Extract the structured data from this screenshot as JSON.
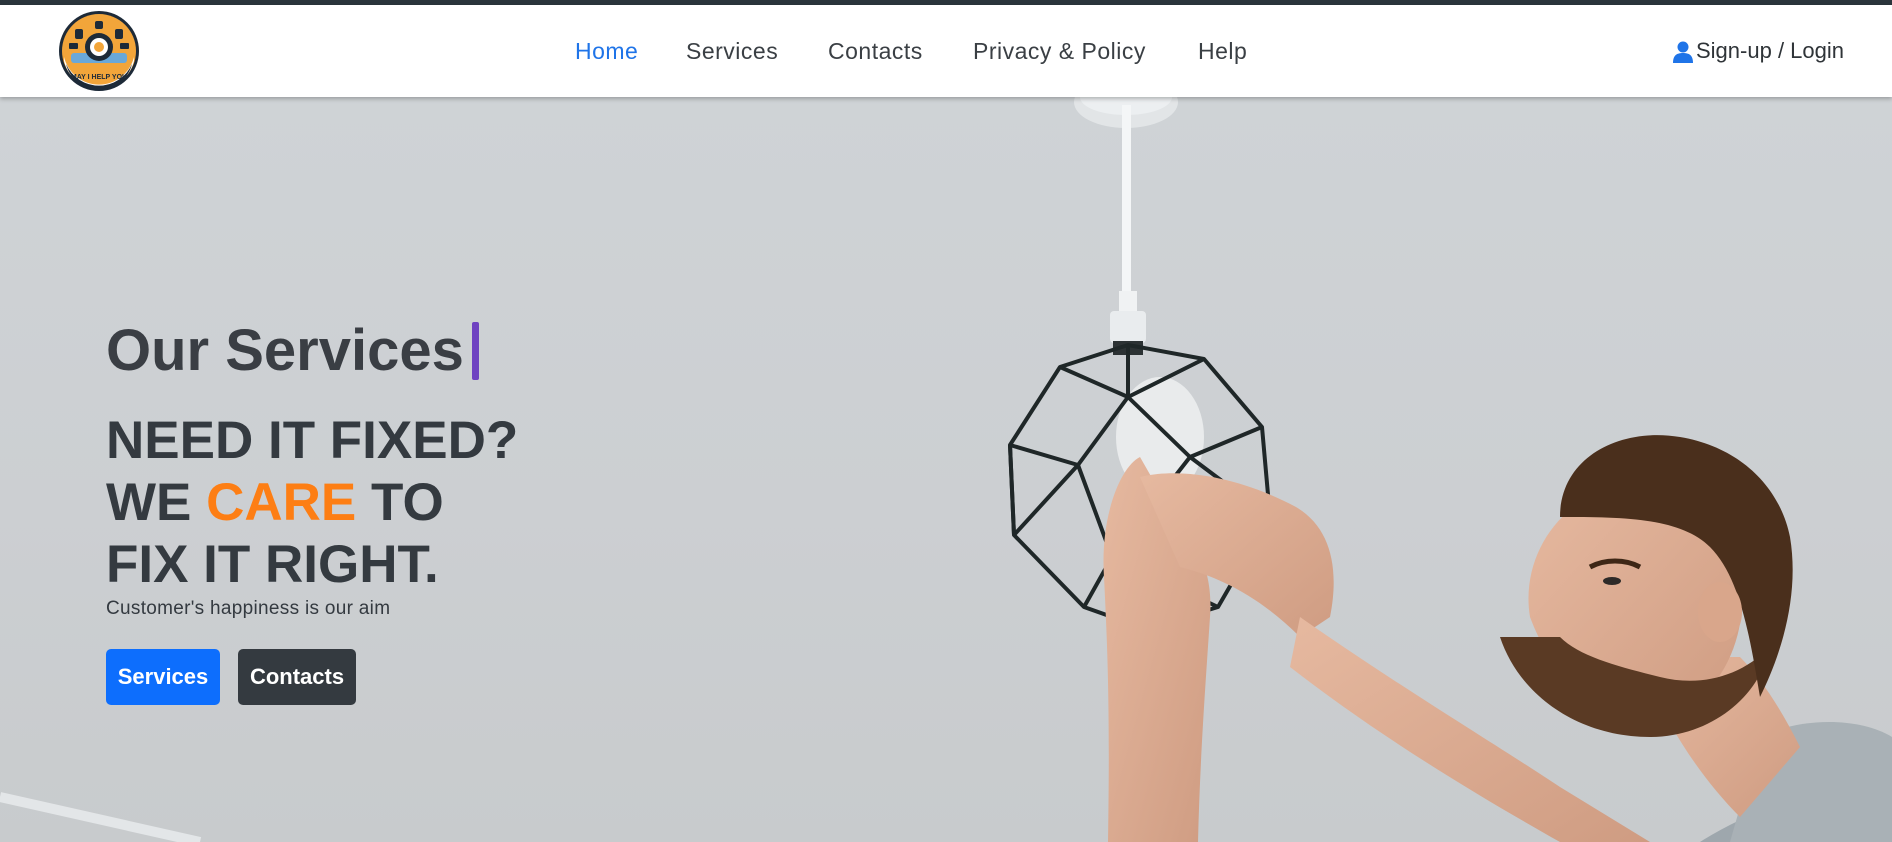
{
  "nav": {
    "logo_text": "MAY I HELP YOU",
    "links": [
      {
        "label": "Home",
        "active": true
      },
      {
        "label": "Services",
        "active": false
      },
      {
        "label": "Contacts",
        "active": false
      },
      {
        "label": "Privacy & Policy",
        "active": false
      },
      {
        "label": "Help",
        "active": false
      }
    ],
    "login_label": "Sign-up / Login",
    "login_icon": "user-icon"
  },
  "hero": {
    "typing_text": "Our Services",
    "headline_line1": "NEED IT FIXED?",
    "headline_line2_before": "WE ",
    "headline_line2_accent": "CARE",
    "headline_line2_after": " TO",
    "headline_line3": "FIX IT RIGHT.",
    "tagline": "Customer's happiness is our aim",
    "buttons": {
      "primary": "Services",
      "secondary": "Contacts"
    }
  },
  "colors": {
    "accent_blue": "#1f74e8",
    "accent_orange": "#fd7e14",
    "caret_purple": "#6f42c1",
    "dark": "#343a40",
    "primary_button": "#0d6efd"
  }
}
